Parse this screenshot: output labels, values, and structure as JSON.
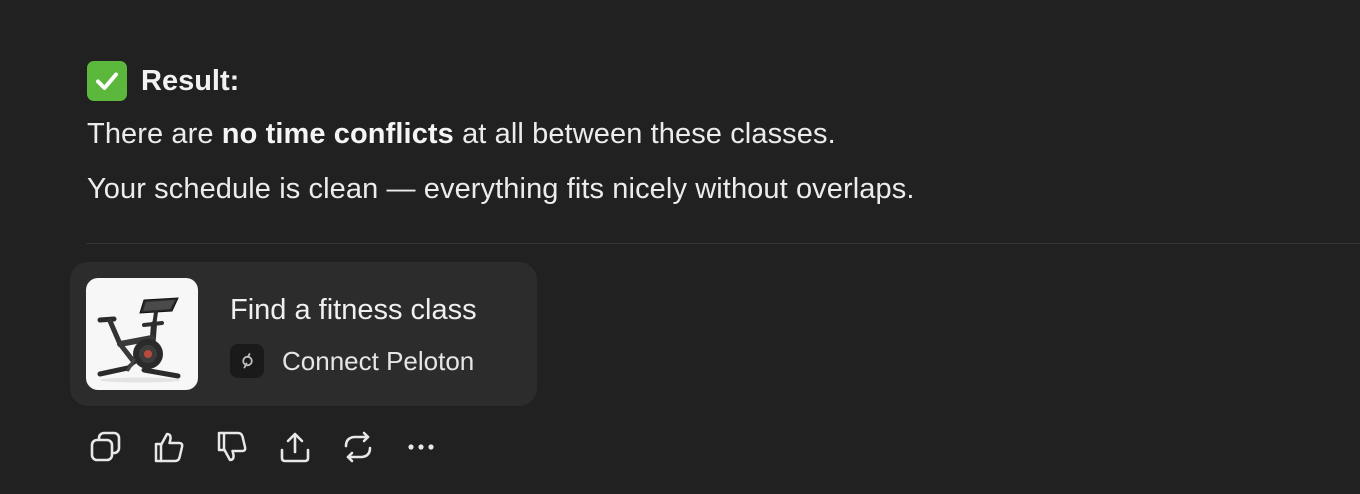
{
  "message": {
    "heading_emoji": "check-mark-button-icon",
    "heading_label": "Result:",
    "line1_before": "There are ",
    "line1_bold": "no time conflicts",
    "line1_after": " at all between these classes.",
    "line2": "Your schedule is clean — everything fits nicely without overlaps."
  },
  "card": {
    "title": "Find a fitness class",
    "connect_label": "Connect Peloton",
    "thumbnail": "exercise-bike-image",
    "connect_icon": "peloton-icon"
  },
  "actions": [
    {
      "name": "copy",
      "icon": "copy-icon"
    },
    {
      "name": "thumbs-up",
      "icon": "thumbs-up-icon"
    },
    {
      "name": "thumbs-down",
      "icon": "thumbs-down-icon"
    },
    {
      "name": "share",
      "icon": "share-icon"
    },
    {
      "name": "regenerate",
      "icon": "refresh-icon"
    },
    {
      "name": "more",
      "icon": "more-icon"
    }
  ],
  "colors": {
    "background": "#212121",
    "card_background": "#2c2c2c",
    "check_green": "#5cb83c",
    "text": "#ececec"
  }
}
